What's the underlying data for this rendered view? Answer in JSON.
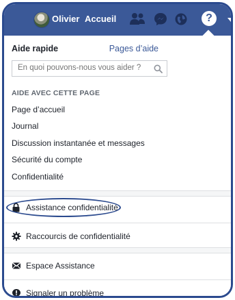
{
  "topbar": {
    "user_name": "Olivier",
    "home_label": "Accueil",
    "friends_icon": "friends-icon",
    "messages_icon": "messenger-icon",
    "notifications_icon": "globe-icon",
    "help_glyph": "?",
    "colors": {
      "bar": "#3b5998",
      "frame": "#2b4a8e"
    }
  },
  "help_panel": {
    "title": "Aide rapide",
    "pages_link": "Pages d’aide",
    "search": {
      "placeholder": "En quoi pouvons-nous vous aider ?",
      "value": ""
    },
    "section_heading": "AIDE AVEC CETTE PAGE",
    "page_links": [
      "Page d’accueil",
      "Journal",
      "Discussion instantanée et messages",
      "Sécurité du compte",
      "Confidentialité"
    ],
    "menu": [
      {
        "label": "Assistance confidentialité",
        "icon": "lock-icon"
      },
      {
        "label": "Raccourcis de confidentialité",
        "icon": "gear-icon"
      },
      {
        "label": "Espace Assistance",
        "icon": "inbox-icon"
      },
      {
        "label": "Signaler un problème",
        "icon": "alert-icon"
      }
    ]
  }
}
